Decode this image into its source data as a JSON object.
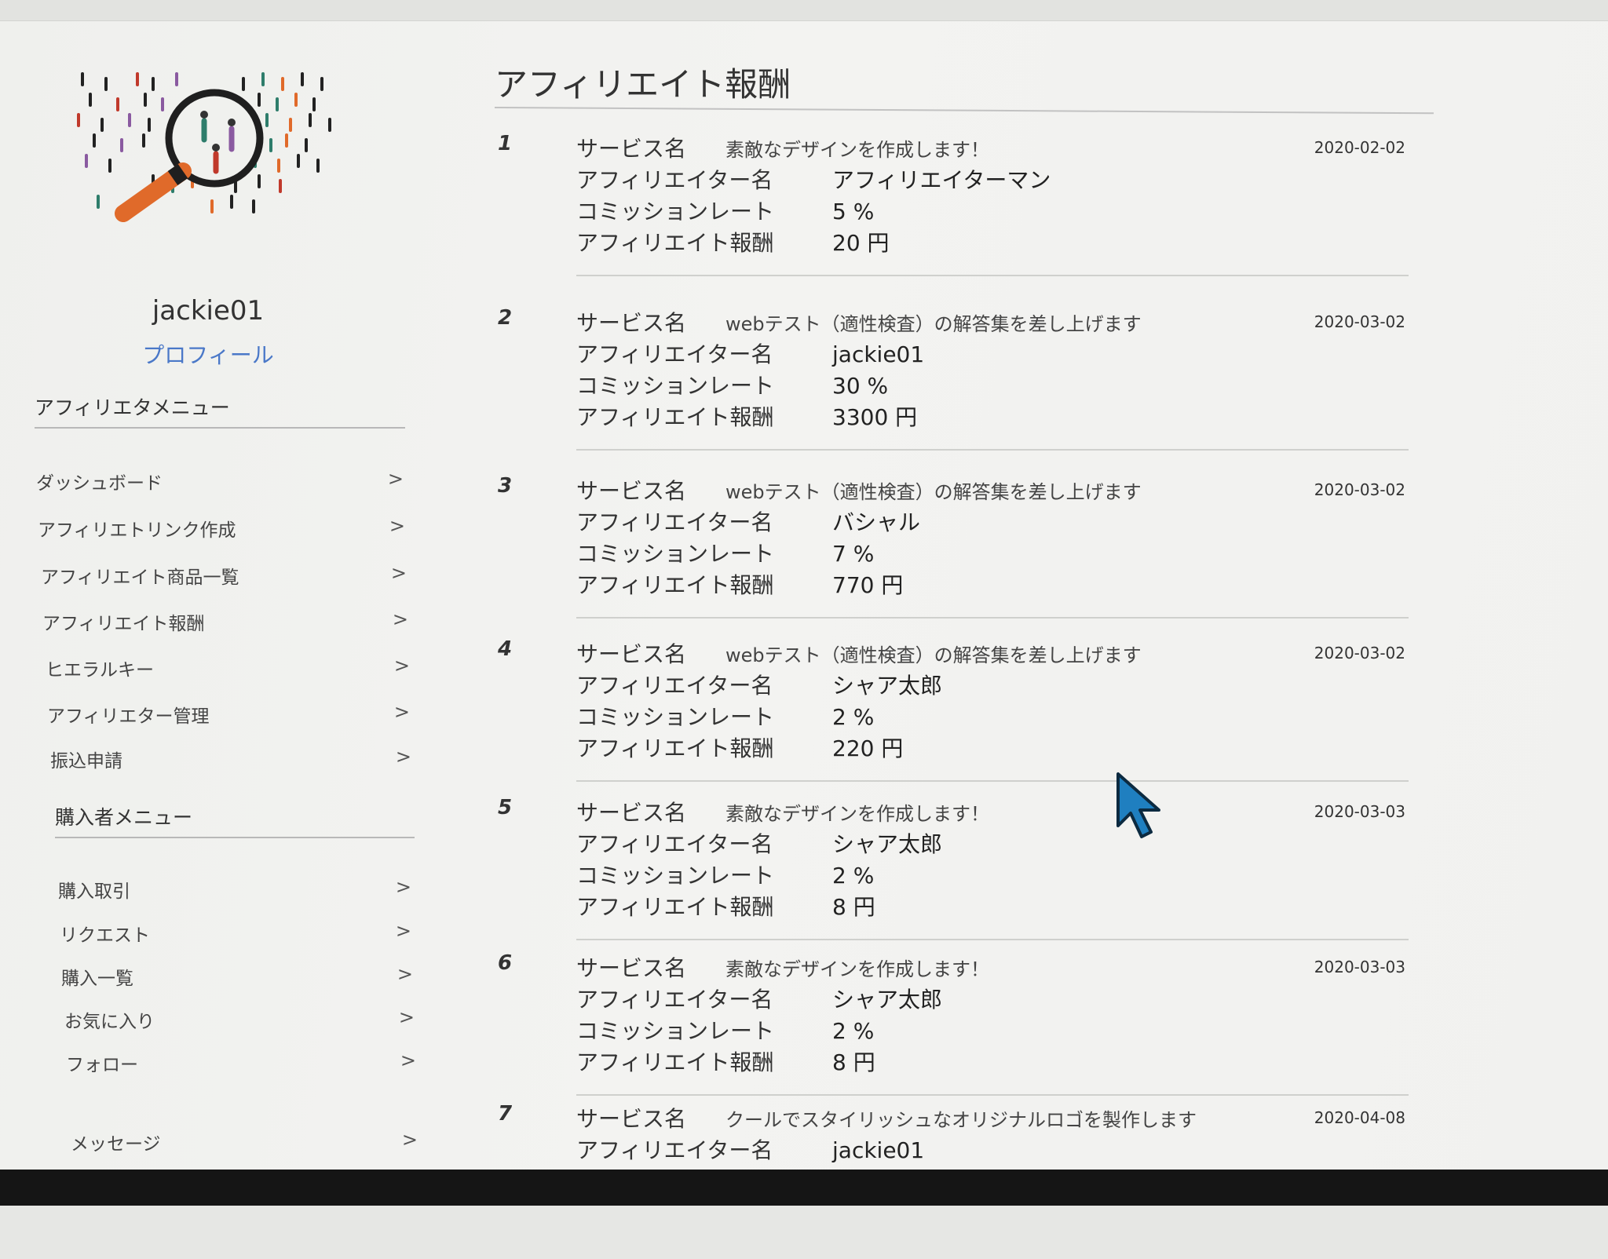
{
  "sidebar": {
    "username": "jackie01",
    "profile_link": "プロフィール",
    "affiliate_menu": {
      "title": "アフィリエタメニュー",
      "items": [
        {
          "label": "ダッシュボード",
          "arrow": ">"
        },
        {
          "label": "アフィリエトリンク作成",
          "arrow": ">"
        },
        {
          "label": "アフィリエイト商品一覧",
          "arrow": ">"
        },
        {
          "label": "アフィリエイト報酬",
          "arrow": ">"
        },
        {
          "label": "ヒエラルキー",
          "arrow": ">"
        },
        {
          "label": "アフィリエター管理",
          "arrow": ">"
        },
        {
          "label": "振込申請",
          "arrow": ">"
        }
      ]
    },
    "buyer_menu": {
      "title": "購入者メニュー",
      "items": [
        {
          "label": "購入取引",
          "arrow": ">"
        },
        {
          "label": "リクエスト",
          "arrow": ">"
        },
        {
          "label": "購入一覧",
          "arrow": ">"
        },
        {
          "label": "お気に入り",
          "arrow": ">"
        },
        {
          "label": "フォロー",
          "arrow": ">"
        },
        {
          "label": "メッセージ",
          "arrow": ">"
        }
      ]
    }
  },
  "main": {
    "title": "アフィリエイト報酬",
    "labels": {
      "service": "サービス名",
      "affiliator": "アフィリエイター名",
      "commission_rate": "コミッションレート",
      "reward": "アフィリエイト報酬"
    },
    "entries": [
      {
        "num": "1",
        "service": "素敵なデザインを作成します！",
        "affiliator": "アフィリエイターマン",
        "rate": "5 %",
        "reward": "20 円",
        "date": "2020-02-02"
      },
      {
        "num": "2",
        "service": "webテスト（適性検査）の解答集を差し上げます",
        "affiliator": "jackie01",
        "rate": "30 %",
        "reward": "3300 円",
        "date": "2020-03-02"
      },
      {
        "num": "3",
        "service": "webテスト（適性検査）の解答集を差し上げます",
        "affiliator": "バシャル",
        "rate": "7 %",
        "reward": "770 円",
        "date": "2020-03-02"
      },
      {
        "num": "4",
        "service": "webテスト（適性検査）の解答集を差し上げます",
        "affiliator": "シャア太郎",
        "rate": "2 %",
        "reward": "220 円",
        "date": "2020-03-02"
      },
      {
        "num": "5",
        "service": "素敵なデザインを作成します！",
        "affiliator": "シャア太郎",
        "rate": "2 %",
        "reward": "8 円",
        "date": "2020-03-03"
      },
      {
        "num": "6",
        "service": "素敵なデザインを作成します！",
        "affiliator": "シャア太郎",
        "rate": "2 %",
        "reward": "8 円",
        "date": "2020-03-03"
      },
      {
        "num": "7",
        "service": "クールでスタイリッシュなオリジナルロゴを製作します",
        "affiliator": "jackie01",
        "rate": "",
        "reward": "",
        "date": "2020-04-08"
      }
    ]
  },
  "colors": {
    "link": "#4a78c8",
    "cursor": "#1f7fc0",
    "logo_accent": "#e06a2a"
  },
  "icons": {
    "logo": "magnifier-people-logo",
    "cursor": "mouse-cursor-icon"
  }
}
